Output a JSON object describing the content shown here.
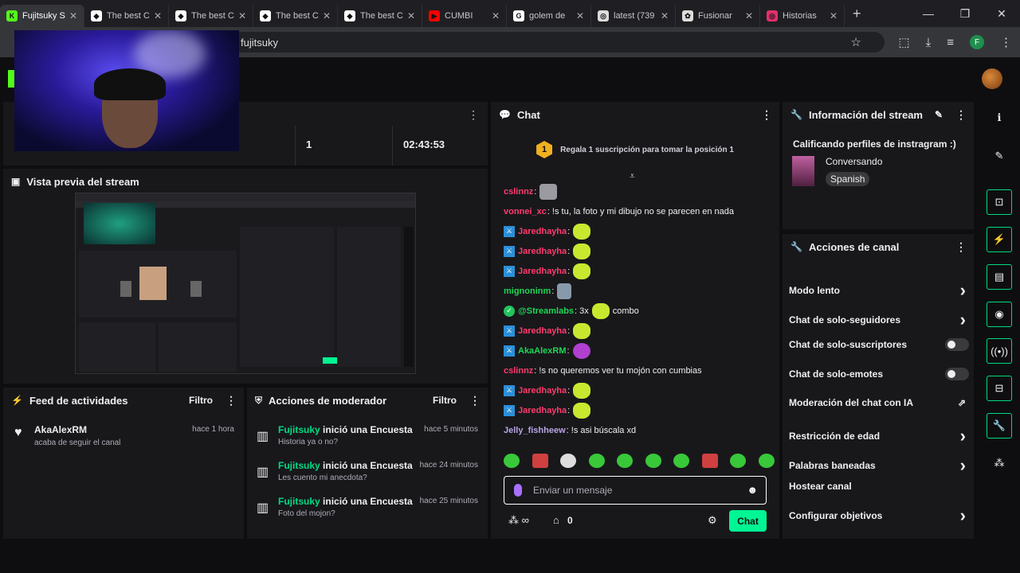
{
  "browser": {
    "tabs": [
      {
        "label": "Fujitsuky S",
        "fav": "K",
        "fav_bg": "#53fc18",
        "active": true
      },
      {
        "label": "The best C",
        "fav": "◆",
        "fav_bg": "#ffffff"
      },
      {
        "label": "The best C",
        "fav": "◆",
        "fav_bg": "#ffffff"
      },
      {
        "label": "The best C",
        "fav": "◆",
        "fav_bg": "#ffffff"
      },
      {
        "label": "The best C",
        "fav": "◆",
        "fav_bg": "#ffffff"
      },
      {
        "label": "CUMBI",
        "fav": "▶",
        "fav_bg": "#ff0000"
      },
      {
        "label": "golem de",
        "fav": "G",
        "fav_bg": "#ffffff"
      },
      {
        "label": "latest (739",
        "fav": "◎",
        "fav_bg": "#dddddd"
      },
      {
        "label": "Fusionar",
        "fav": "✿",
        "fav_bg": "#dddddd"
      },
      {
        "label": "Historias",
        "fav": "◎",
        "fav_bg": "#e1306c"
      }
    ],
    "url": "fujitsuky",
    "profile_initial": "F"
  },
  "stats": {
    "value_1": "1",
    "value_2": "02:43:53"
  },
  "preview": {
    "title": "Vista previa del stream"
  },
  "feed": {
    "title": "Feed de actividades",
    "filter": "Filtro",
    "items": [
      {
        "user": "AkaAlexRM",
        "time": "hace 1 hora",
        "desc": "acaba de seguir el canal"
      }
    ]
  },
  "mod_actions": {
    "title": "Acciones de moderador",
    "filter": "Filtro",
    "items": [
      {
        "user": "Fujitsuky",
        "action": "inició una Encuesta",
        "time": "hace 5 minutos",
        "desc": "Historia ya o no?"
      },
      {
        "user": "Fujitsuky",
        "action": "inició una Encuesta",
        "time": "hace 24 minutos",
        "desc": "Les cuento mi anecdota?"
      },
      {
        "user": "Fujitsuky",
        "action": "inició una Encuesta",
        "time": "hace 25 minutos",
        "desc": "Foto del mojon?"
      }
    ]
  },
  "chat": {
    "title": "Chat",
    "pinned": "Regala 1 suscripción para tomar la posición 1",
    "pinned_rank": "1",
    "messages": [
      {
        "user": "cslinnz",
        "color": "#ff3c6e",
        "badge": "",
        "text": ":",
        "emote": "grey"
      },
      {
        "user": "vonnei_xc",
        "color": "#ff3c6e",
        "badge": "",
        "text": ": !s tu, la foto y mi dibujo no se parecen en nada",
        "emote": ""
      },
      {
        "user": "Jaredhayha",
        "color": "#ff3c6e",
        "badge": "mod",
        "text": ":",
        "emote": "cat"
      },
      {
        "user": "Jaredhayha",
        "color": "#ff3c6e",
        "badge": "mod",
        "text": ":",
        "emote": "cat"
      },
      {
        "user": "Jaredhayha",
        "color": "#ff3c6e",
        "badge": "mod",
        "text": ":",
        "emote": "cat"
      },
      {
        "user": "mignoninm",
        "color": "#1fd655",
        "badge": "",
        "text": ":",
        "emote": "rat"
      },
      {
        "user": "@Streamlabs",
        "color": "#1fd655",
        "badge": "verified",
        "text": ": 3x",
        "emote": "cat",
        "after": "combo"
      },
      {
        "user": "Jaredhayha",
        "color": "#ff3c6e",
        "badge": "mod",
        "text": ":",
        "emote": "cat"
      },
      {
        "user": "AkaAlexRM",
        "color": "#1fd655",
        "badge": "mod",
        "text": ":",
        "emote": "purple"
      },
      {
        "user": "cslinnz",
        "color": "#ff3c6e",
        "badge": "",
        "text": ": !s no queremos ver tu mojón con cumbias",
        "emote": ""
      },
      {
        "user": "Jaredhayha",
        "color": "#ff3c6e",
        "badge": "mod",
        "text": ":",
        "emote": "cat"
      },
      {
        "user": "Jaredhayha",
        "color": "#ff3c6e",
        "badge": "mod",
        "text": ":",
        "emote": "cat"
      },
      {
        "user": "Jelly_fishheew",
        "color": "#b9a3e3",
        "badge": "",
        "text": ": !s asi búscala xd",
        "emote": ""
      }
    ],
    "input_placeholder": "Enviar un mensaje",
    "points": "0",
    "send_label": "Chat"
  },
  "stream_info": {
    "title": "Información del stream",
    "stream_title": "Calificando perfiles de instragram :)",
    "category": "Conversando",
    "language": "Spanish"
  },
  "channel_actions": {
    "title": "Acciones de canal",
    "items": [
      {
        "label": "Modo lento",
        "control": "chevron"
      },
      {
        "label": "Chat de solo-seguidores",
        "control": "chevron"
      },
      {
        "label": "Chat de solo-suscriptores",
        "control": "toggle"
      },
      {
        "label": "Chat de solo-emotes",
        "control": "toggle"
      },
      {
        "label": "Moderación del chat con IA",
        "control": "external"
      },
      {
        "label": "Restricción de edad",
        "control": "chevron"
      },
      {
        "label": "Palabras baneadas",
        "control": "chevron"
      },
      {
        "label": "Hostear canal",
        "control": "none"
      },
      {
        "label": "Configurar objetivos",
        "control": "chevron"
      }
    ]
  },
  "colors": {
    "accent": "#00db84",
    "kick_green": "#53fc18",
    "mod_blue": "#2b8fd8",
    "send_button": "#00f593"
  }
}
